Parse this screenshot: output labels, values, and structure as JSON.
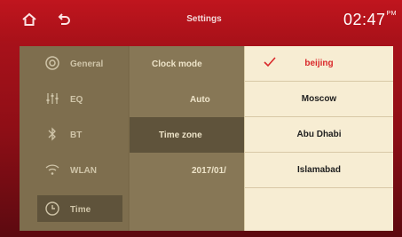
{
  "header": {
    "title": "Settings",
    "time": "02:47",
    "time_suffix": "PM"
  },
  "sidebar": {
    "items": [
      {
        "label": "General",
        "icon": "gear-icon"
      },
      {
        "label": "EQ",
        "icon": "equalizer-icon"
      },
      {
        "label": "BT",
        "icon": "bluetooth-icon"
      },
      {
        "label": "WLAN",
        "icon": "wifi-icon"
      },
      {
        "label": "Time",
        "icon": "clock-icon",
        "active": true
      }
    ]
  },
  "main": {
    "rows": [
      {
        "label": "Clock mode"
      },
      {
        "label": "Auto"
      },
      {
        "label": "Time zone",
        "highlighted": true
      },
      {
        "label": "2017/01/"
      }
    ]
  },
  "dropdown": {
    "selected": "beijing",
    "options": [
      "beijing",
      "Moscow",
      "Abu Dhabi",
      "Islamabad"
    ]
  },
  "colors": {
    "accent": "#d9282a",
    "topbar": "#b4131c",
    "panel": "#7b6b4b",
    "dropdown_bg": "#f7edd3"
  }
}
